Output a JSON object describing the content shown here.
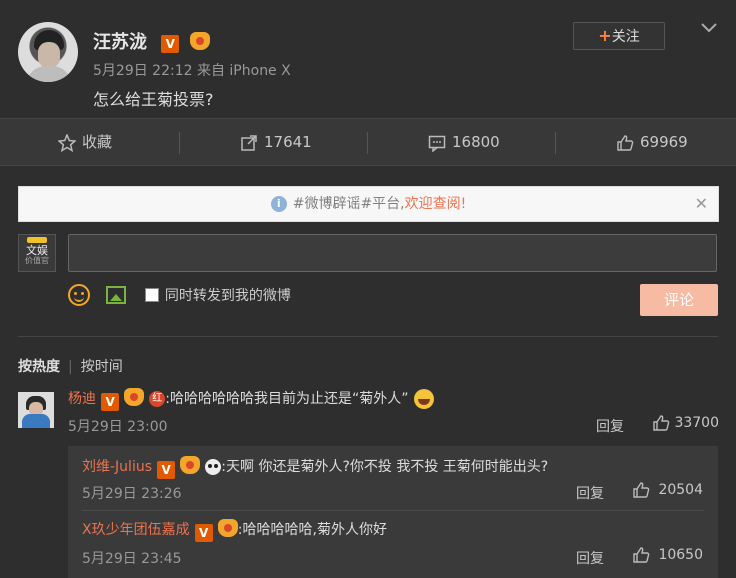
{
  "post": {
    "author": "汪苏泷",
    "meta": "5月29日 22:12 来自 iPhone X",
    "content": "怎么给王菊投票?",
    "follow_label": "关注"
  },
  "actions": {
    "favorite": "收藏",
    "repost": "17641",
    "comment": "16800",
    "like": "69969"
  },
  "notice": {
    "prefix": "#微博辟谣#平台,",
    "highlight": "欢迎查阅!"
  },
  "composer": {
    "logo_line1": "文娱",
    "logo_line2": "价值官",
    "checkbox_label": "同时转发到我的微博",
    "submit_label": "评论"
  },
  "sort": {
    "hot": "按热度",
    "time": "按时间"
  },
  "comments": [
    {
      "name": "杨迪",
      "text": ":哈哈哈哈哈哈我目前为止还是“菊外人”",
      "time": "5月29日 23:00",
      "reply": "回复",
      "likes": "33700"
    }
  ],
  "replies": [
    {
      "name": "刘维-Julius",
      "text": ":天啊 你还是菊外人?你不投 我不投 王菊何时能出头?",
      "time": "5月29日 23:26",
      "reply": "回复",
      "likes": "20504"
    },
    {
      "name": "X玖少年团伍嘉成",
      "text": ":哈哈哈哈哈,菊外人你好",
      "time": "5月29日 23:45",
      "reply": "回复",
      "likes": "10650"
    }
  ],
  "colors": {
    "background": "#2e2e2e",
    "accent": "#eb7350",
    "verified": "#e25a00",
    "submit": "#f7bba4"
  }
}
